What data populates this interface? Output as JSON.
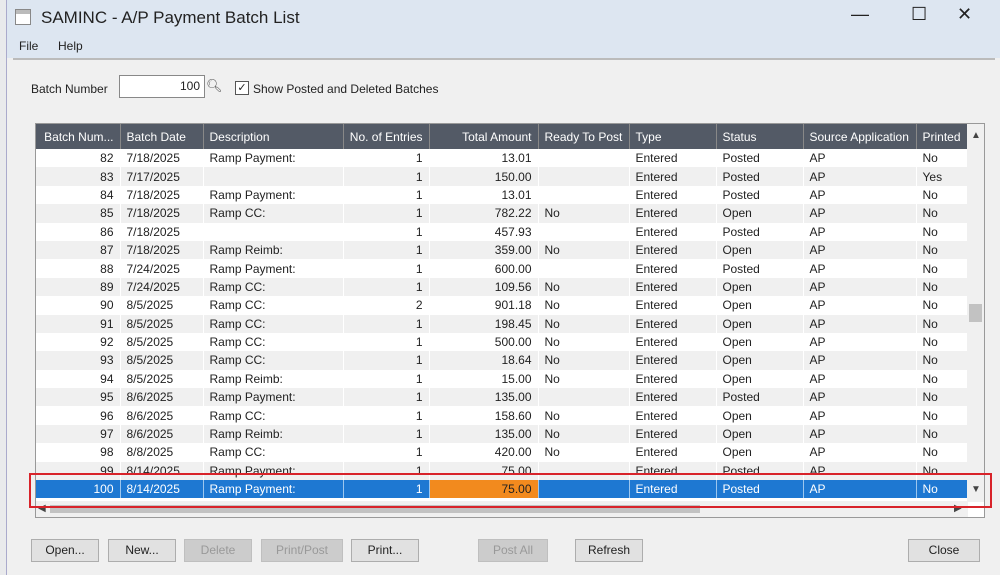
{
  "window": {
    "title": "SAMINC - A/P Payment Batch List",
    "minimize": "—",
    "maximize": "☐",
    "close": "✕"
  },
  "menu": [
    "File",
    "Help"
  ],
  "filter": {
    "batch_label": "Batch Number",
    "batch_value": "100",
    "show_posted_label": "Show Posted and Deleted Batches",
    "show_posted_checked": true
  },
  "columns": [
    "Batch Num...",
    "Batch Date",
    "Description",
    "No. of Entries",
    "Total Amount",
    "Ready To Post",
    "Type",
    "Status",
    "Source Application",
    "Printed"
  ],
  "rows": [
    [
      "82",
      "7/18/2025",
      "Ramp Payment:",
      "1",
      "13.01",
      "",
      "Entered",
      "Posted",
      "AP",
      "No"
    ],
    [
      "83",
      "7/17/2025",
      "",
      "1",
      "150.00",
      "",
      "Entered",
      "Posted",
      "AP",
      "Yes"
    ],
    [
      "84",
      "7/18/2025",
      "Ramp Payment:",
      "1",
      "13.01",
      "",
      "Entered",
      "Posted",
      "AP",
      "No"
    ],
    [
      "85",
      "7/18/2025",
      "Ramp CC:",
      "1",
      "782.22",
      "No",
      "Entered",
      "Open",
      "AP",
      "No"
    ],
    [
      "86",
      "7/18/2025",
      "",
      "1",
      "457.93",
      "",
      "Entered",
      "Posted",
      "AP",
      "No"
    ],
    [
      "87",
      "7/18/2025",
      "Ramp Reimb:",
      "1",
      "359.00",
      "No",
      "Entered",
      "Open",
      "AP",
      "No"
    ],
    [
      "88",
      "7/24/2025",
      "Ramp Payment:",
      "1",
      "600.00",
      "",
      "Entered",
      "Posted",
      "AP",
      "No"
    ],
    [
      "89",
      "7/24/2025",
      "Ramp CC:",
      "1",
      "109.56",
      "No",
      "Entered",
      "Open",
      "AP",
      "No"
    ],
    [
      "90",
      "8/5/2025",
      "Ramp CC:",
      "2",
      "901.18",
      "No",
      "Entered",
      "Open",
      "AP",
      "No"
    ],
    [
      "91",
      "8/5/2025",
      "Ramp CC:",
      "1",
      "198.45",
      "No",
      "Entered",
      "Open",
      "AP",
      "No"
    ],
    [
      "92",
      "8/5/2025",
      "Ramp CC:",
      "1",
      "500.00",
      "No",
      "Entered",
      "Open",
      "AP",
      "No"
    ],
    [
      "93",
      "8/5/2025",
      "Ramp CC:",
      "1",
      "18.64",
      "No",
      "Entered",
      "Open",
      "AP",
      "No"
    ],
    [
      "94",
      "8/5/2025",
      "Ramp Reimb:",
      "1",
      "15.00",
      "No",
      "Entered",
      "Open",
      "AP",
      "No"
    ],
    [
      "95",
      "8/6/2025",
      "Ramp Payment:",
      "1",
      "135.00",
      "",
      "Entered",
      "Posted",
      "AP",
      "No"
    ],
    [
      "96",
      "8/6/2025",
      "Ramp CC:",
      "1",
      "158.60",
      "No",
      "Entered",
      "Open",
      "AP",
      "No"
    ],
    [
      "97",
      "8/6/2025",
      "Ramp Reimb:",
      "1",
      "135.00",
      "No",
      "Entered",
      "Open",
      "AP",
      "No"
    ],
    [
      "98",
      "8/8/2025",
      "Ramp CC:",
      "1",
      "420.00",
      "No",
      "Entered",
      "Open",
      "AP",
      "No"
    ],
    [
      "99",
      "8/14/2025",
      "Ramp Payment:",
      "1",
      "75.00",
      "",
      "Entered",
      "Posted",
      "AP",
      "No"
    ],
    [
      "100",
      "8/14/2025",
      "Ramp Payment:",
      "1",
      "75.00",
      "",
      "Entered",
      "Posted",
      "AP",
      "No"
    ]
  ],
  "selected_row": "100",
  "buttons": [
    {
      "label": "Open...",
      "enabled": true
    },
    {
      "label": "New...",
      "enabled": true
    },
    {
      "label": "Delete",
      "enabled": false
    },
    {
      "label": "Print/Post",
      "enabled": false
    },
    {
      "label": "Print...",
      "enabled": true
    },
    {
      "label": "Post All",
      "enabled": false
    },
    {
      "label": "Refresh",
      "enabled": true
    },
    {
      "label": "Close",
      "enabled": true
    }
  ],
  "colors": {
    "header": "#535a66",
    "selection": "#1e78d2",
    "highlight_cell": "#f28a1e",
    "annotation_box": "#d8232a"
  }
}
